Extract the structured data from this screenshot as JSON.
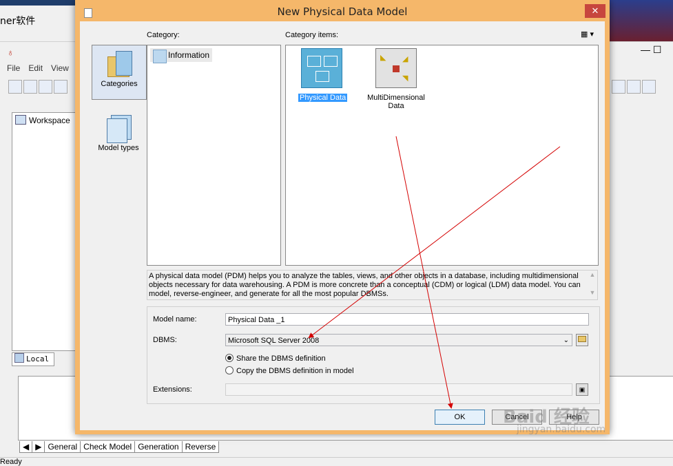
{
  "background": {
    "title_fragment": "ner软件",
    "menu": [
      "File",
      "Edit",
      "View"
    ],
    "workspace_item": "Workspace",
    "local_tab": "Local",
    "bottom_tabs": [
      "General",
      "Check Model",
      "Generation",
      "Reverse"
    ],
    "status": "Ready"
  },
  "dialog": {
    "title": "New Physical Data Model",
    "close_glyph": "✕",
    "left_buttons": [
      "Categories",
      "Model types"
    ],
    "category_label": "Category:",
    "category_items_label": "Category items:",
    "categories": [
      "Information"
    ],
    "items": [
      "Physical Data",
      "MultiDimensional Data"
    ],
    "description": "A physical data model (PDM) helps you to analyze the tables, views, and other objects in a database, including multidimensional objects necessary for data warehousing. A PDM is more concrete than a conceptual (CDM) or logical (LDM) data model. You can model, reverse-engineer, and generate for all the most popular DBMSs.",
    "model_name_label": "Model name:",
    "model_name_value": "Physical Data _1",
    "dbms_label": "DBMS:",
    "dbms_value": "Microsoft SQL Server 2008",
    "radio_share": "Share the DBMS definition",
    "radio_copy": "Copy the DBMS definition in model",
    "extensions_label": "Extensions:",
    "ok": "OK",
    "cancel": "Cancel",
    "help": "Help"
  },
  "watermark": {
    "line1": "Baid 经验",
    "line2": "jingyan.baidu.com"
  },
  "colors": {
    "frame": "#f5b76a",
    "close": "#c7463e",
    "selection": "#3399ff",
    "arrow": "#d40000"
  }
}
